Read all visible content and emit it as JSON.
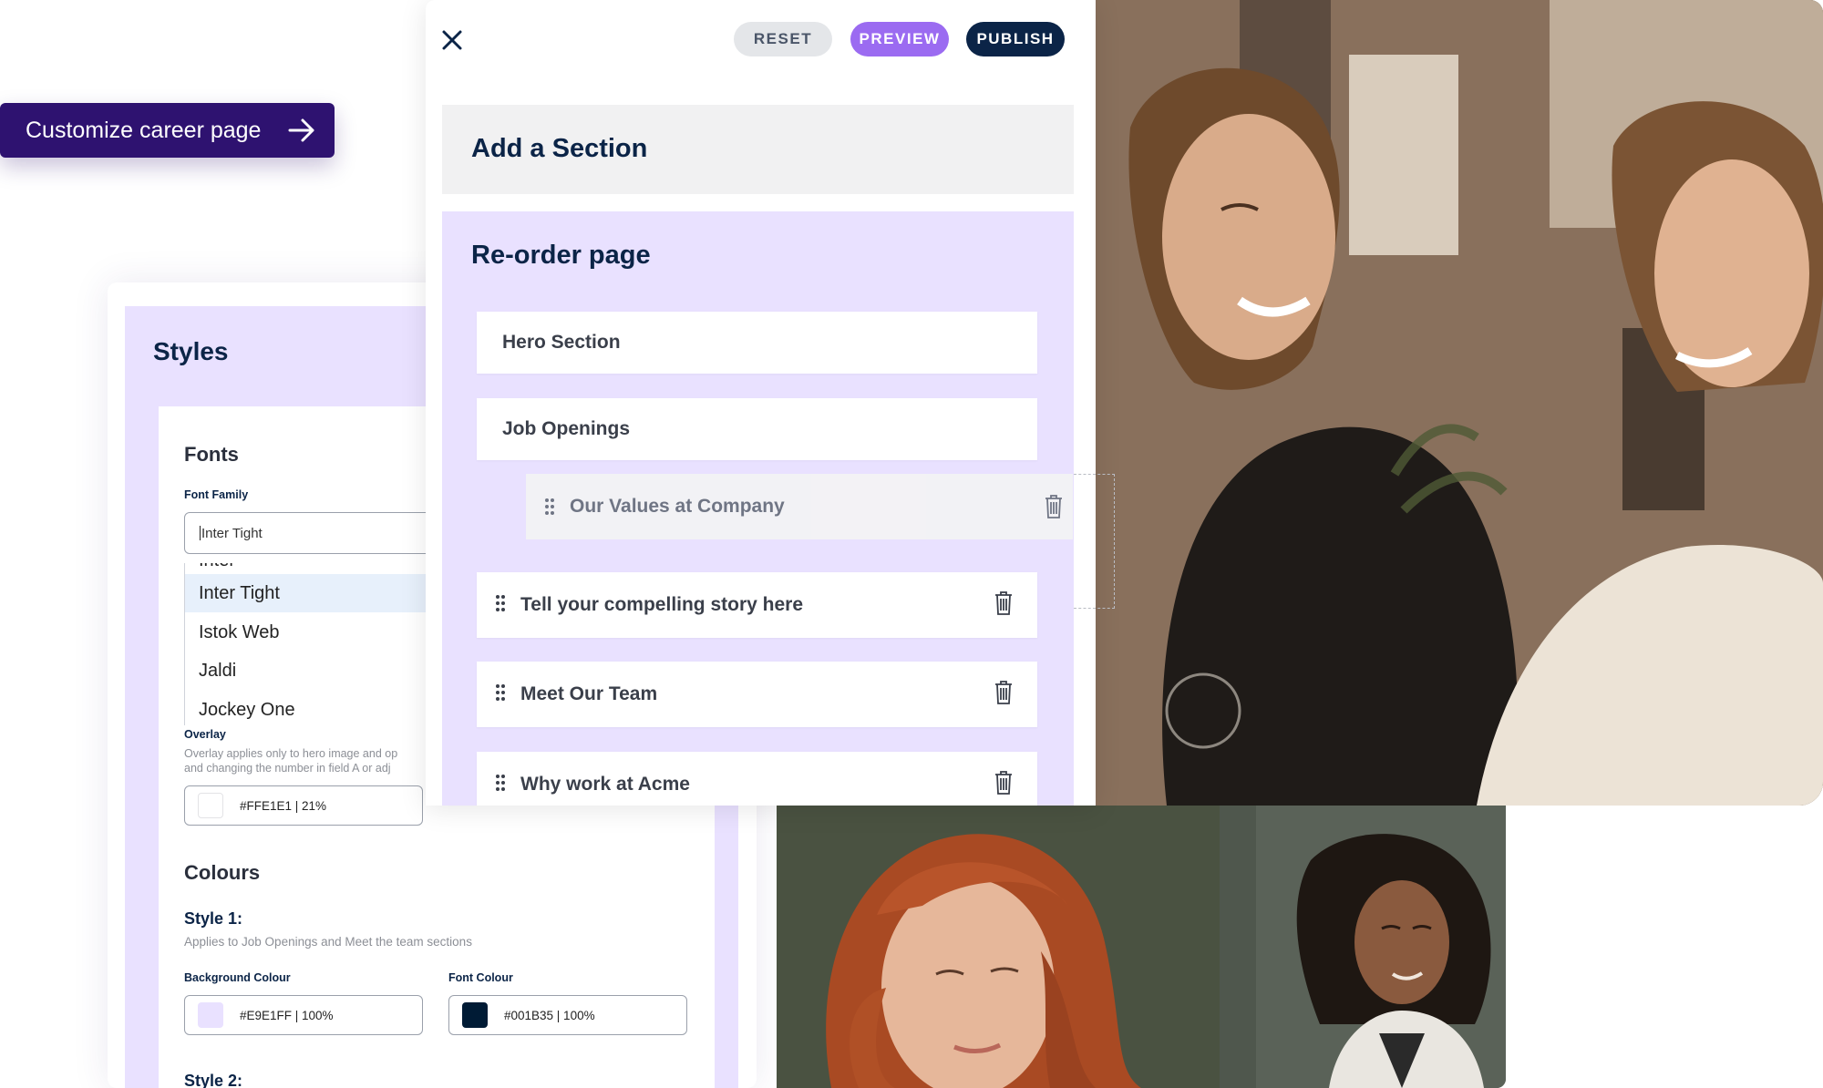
{
  "cta": {
    "label": "Customize career page"
  },
  "styles": {
    "title": "Styles",
    "fonts_heading": "Fonts",
    "font_family_label": "Font Family",
    "font_family_value": "Inter Tight",
    "font_options": [
      "Inter",
      "Inter Tight",
      "Istok Web",
      "Jaldi",
      "Jockey One"
    ],
    "overlay_label": "Overlay",
    "overlay_desc_1": "Overlay applies only to hero image and op",
    "overlay_desc_2": "and changing the number in field A or adj",
    "overlay_value": "#FFE1E1 | 21%",
    "overlay_color": "#FFE1E1",
    "colours_heading": "Colours",
    "style1_heading": "Style 1:",
    "style1_desc": "Applies to Job Openings and Meet the team sections",
    "bg_colour_label": "Background Colour",
    "bg_colour_value": "#E9E1FF | 100%",
    "bg_colour": "#E9E1FF",
    "font_colour_label": "Font Colour",
    "font_colour_value": "#001B35 | 100%",
    "font_colour": "#001B35",
    "style2_heading": "Style 2:"
  },
  "toolbar": {
    "reset": "RESET",
    "preview": "PREVIEW",
    "publish": "PUBLISH"
  },
  "add_section": {
    "title": "Add a Section"
  },
  "reorder": {
    "title": "Re-order page",
    "fixed_sections": [
      "Hero Section",
      "Job Openings"
    ],
    "dragging_section": "Our Values at Company",
    "sections": [
      "Tell your compelling story here",
      "Meet Our Team",
      "Why work at Acme"
    ]
  },
  "colors": {
    "brand_dark": "#2E1270",
    "navy": "#0B2447",
    "lavender": "#E9E1FF",
    "preview_purple": "#9B6BF1"
  }
}
